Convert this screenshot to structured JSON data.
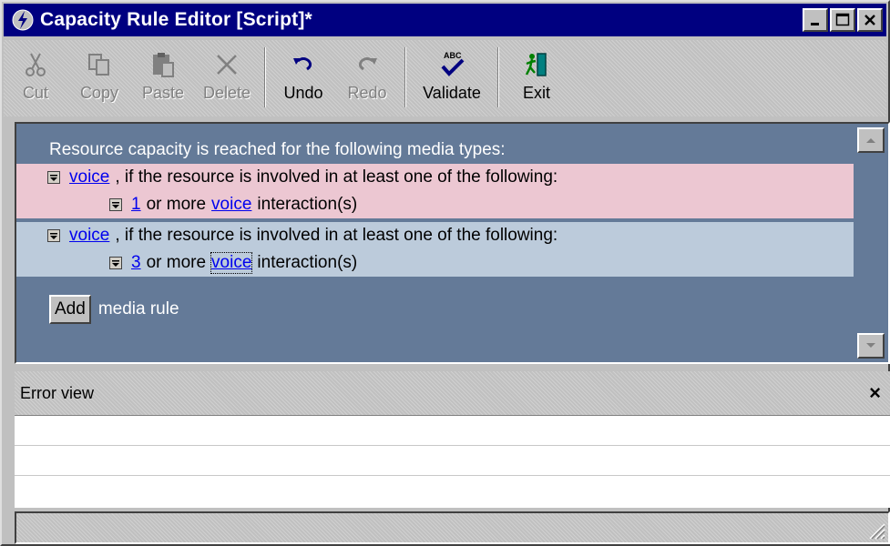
{
  "window": {
    "title": "Capacity Rule Editor [Script]*",
    "title_bar_color": "#000080",
    "controls": [
      "minimize-icon",
      "maximize-icon",
      "close-icon"
    ]
  },
  "toolbar": {
    "items": [
      {
        "label": "Cut",
        "icon": "scissors-icon",
        "enabled": false
      },
      {
        "label": "Copy",
        "icon": "copy-icon",
        "enabled": false
      },
      {
        "label": "Paste",
        "icon": "paste-icon",
        "enabled": false
      },
      {
        "label": "Delete",
        "icon": "delete-x-icon",
        "enabled": false
      },
      {
        "label": "Undo",
        "icon": "undo-arrow-icon",
        "enabled": true
      },
      {
        "label": "Redo",
        "icon": "redo-arrow-icon",
        "enabled": false
      },
      {
        "label": "Validate",
        "icon": "abc-check-icon",
        "enabled": true
      },
      {
        "label": "Exit",
        "icon": "exit-door-icon",
        "enabled": true
      }
    ]
  },
  "editor": {
    "header": "Resource capacity is reached for the following media types:",
    "rules": [
      {
        "media": "voice",
        "condition": ", if the resource is involved in at least one of the following:",
        "sub": {
          "count": "1",
          "text_before": "or more",
          "media": "voice",
          "text_after": "interaction(s)"
        },
        "color": "#ecc7d2"
      },
      {
        "media": "voice",
        "condition": ", if the resource is involved in at least one of the following:",
        "sub": {
          "count": "3",
          "text_before": "or more",
          "media": "voice",
          "text_after": "interaction(s)"
        },
        "color": "#bccbdb"
      }
    ],
    "add_button": "Add",
    "add_label": "media rule",
    "background": "#647a98"
  },
  "error_view": {
    "title": "Error view",
    "close": "×"
  }
}
